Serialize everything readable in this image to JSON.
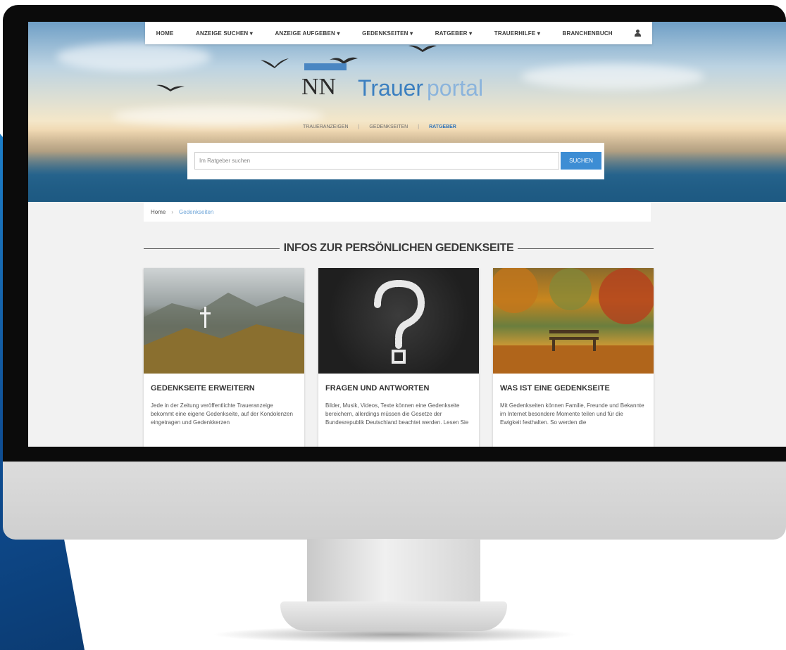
{
  "nav": {
    "items": [
      "HOME",
      "ANZEIGE SUCHEN ▾",
      "ANZEIGE AUFGEBEN ▾",
      "GEDENKSEITEN ▾",
      "RATGEBER ▾",
      "TRAUERHILFE ▾",
      "BRANCHENBUCH"
    ],
    "user_icon": "user-icon"
  },
  "logo": {
    "nn": "NN",
    "trauer": "Trauer",
    "portal": "portal"
  },
  "subtabs": {
    "items": [
      "TRAUERANZEIGEN",
      "GEDENKSEITEN",
      "RATGEBER"
    ],
    "active": "RATGEBER"
  },
  "search": {
    "placeholder": "Im Ratgeber suchen",
    "button": "SUCHEN"
  },
  "breadcrumb": {
    "home": "Home",
    "sep": "›",
    "current": "Gedenkseiten"
  },
  "section_title": "INFOS ZUR PERSÖNLICHEN GEDENKSEITE",
  "cards": [
    {
      "title": "GEDENKSEITE ERWEITERN",
      "text": "Jede in der Zeitung veröffentlichte Traueranzeige bekommt eine eigene Gedenkseite, auf der Kondolenzen eingetragen und Gedenkkerzen"
    },
    {
      "title": "FRAGEN UND ANTWORTEN",
      "text": "Bilder, Musik, Videos, Texte können eine Gedenkseite bereichern, allerdings müssen die Gesetze der Bundesrepublik Deutschland beachtet werden. Lesen Sie"
    },
    {
      "title": "WAS IST EINE GEDENKSEITE",
      "text": "Mit Gedenkseiten können Familie, Freunde und Bekannte im Internet besondere Momente teilen und für die Ewigkeit festhalten. So werden die"
    }
  ],
  "colors": {
    "accent": "#3d8dd4",
    "logo_blue": "#3b7fc0",
    "band_blue": "#1d7fc9"
  }
}
